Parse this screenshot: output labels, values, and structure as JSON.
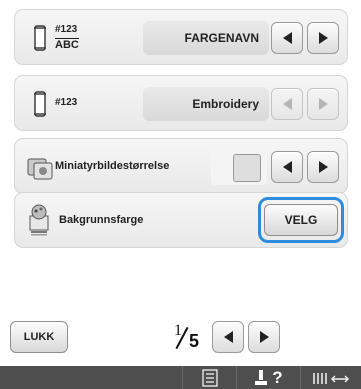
{
  "rows": [
    {
      "label": "#123",
      "sublabel": "ABC",
      "value": "FARGENAVN",
      "icon": "thread-spool-icon"
    },
    {
      "label": "#123",
      "value": "Embroidery",
      "icon": "thread-spool-icon"
    },
    {
      "label": "Miniatyrbildestørrelse",
      "icon": "thumbnail-icon"
    },
    {
      "label": "Bakgrunnsfarge",
      "button": "VELG",
      "icon": "palette-icon"
    }
  ],
  "footer": {
    "close_label": "LUKK",
    "page_current": "1",
    "page_total": "5",
    "help_label": "?"
  },
  "colors": {
    "accent": "#2f8be0",
    "bottom_bar": "#4e4e4e",
    "row_bg": "#eeeeee"
  }
}
